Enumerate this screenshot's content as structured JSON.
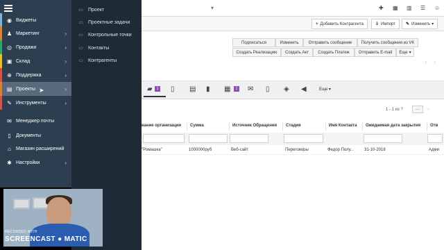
{
  "sidebar": {
    "items": [
      {
        "label": "Виджеты",
        "icon": "dashboard-icon",
        "color": "#7fb3d5"
      },
      {
        "label": "Маркетинг",
        "icon": "people-icon",
        "color": "#e67e22"
      },
      {
        "label": "Продажи",
        "icon": "target-icon",
        "color": "#27ae60"
      },
      {
        "label": "Склад",
        "icon": "box-icon",
        "color": "#f1c40f"
      },
      {
        "label": "Поддержка",
        "icon": "lifebuoy-icon",
        "color": "#e74c3c"
      },
      {
        "label": "Проекты",
        "icon": "briefcase-icon",
        "color": "#e67e22"
      },
      {
        "label": "Инструменты",
        "icon": "wrench-icon",
        "color": "#e74c3c"
      },
      {
        "label": "Менеджер почты",
        "icon": "mail-icon",
        "color": ""
      },
      {
        "label": "Документы",
        "icon": "document-icon",
        "color": ""
      },
      {
        "label": "Магазин расширений",
        "icon": "store-icon",
        "color": ""
      },
      {
        "label": "Настройки",
        "icon": "gear-icon",
        "color": ""
      }
    ]
  },
  "submenu": {
    "items": [
      {
        "label": "Проект",
        "icon": "folder-icon"
      },
      {
        "label": "Проектные задачи",
        "icon": "task-icon"
      },
      {
        "label": "Контрольные точки",
        "icon": "flag-icon"
      },
      {
        "label": "Контакты",
        "icon": "contact-icon"
      },
      {
        "label": "Контрагенты",
        "icon": "building-icon"
      }
    ]
  },
  "actions": {
    "add": "Добавить Контрагента",
    "import": "Импорт",
    "edit": "Изменить"
  },
  "buttons": {
    "subscribe": "Подписаться",
    "edit": "Изменить",
    "send_message": "Отправить сообщение",
    "get_messages_vk": "Получить сообщения из VK",
    "create_realization": "Создать Реализацию",
    "create_act": "Создать Акт",
    "create_payment": "Создать Платеж",
    "send_email": "Отправить E-mail",
    "more": "Еще"
  },
  "tabs": {
    "badge_first": "1",
    "badge_calendar": "1",
    "more": "Еще"
  },
  "list": {
    "pager": "1 - 1 из ?",
    "columns": [
      "вание организации",
      "Сумма",
      "Источник Обращения",
      "Стадия",
      "Имя Контакта",
      "Ожидаемая дата закрытия",
      "Отв"
    ],
    "rows": [
      [
        "\"Ромашка\"",
        "1000000руб",
        "Веб-сайт",
        "Переговоры",
        "Федор Полу...",
        "31-10-2018",
        "Адми"
      ]
    ]
  },
  "webcam": {
    "recorded_with": "RECORDED WITH",
    "brand": "SCREENCAST ● MATIC"
  }
}
